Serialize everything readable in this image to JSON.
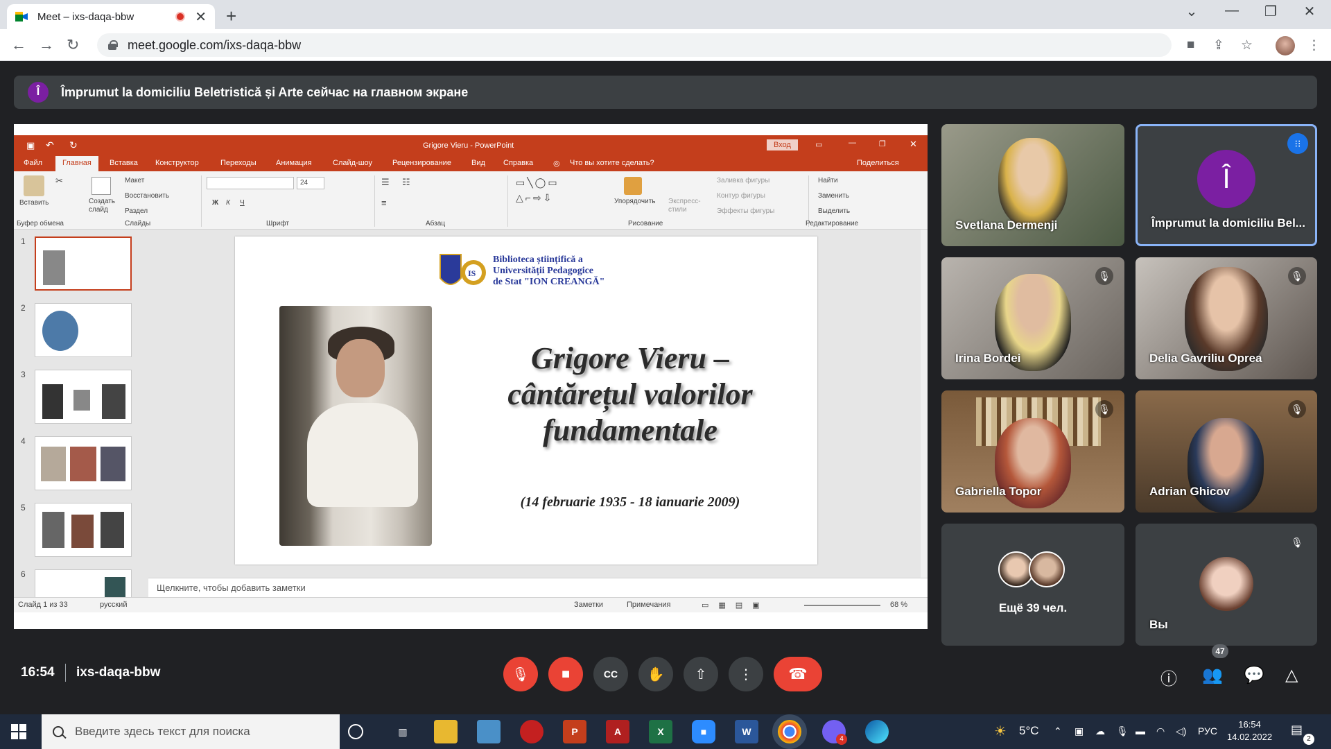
{
  "browser": {
    "tab_title": "Meet – ixs-daqa-bbw",
    "tab_close": "✕",
    "new_tab": "+",
    "url": "meet.google.com/ixs-daqa-bbw",
    "window_controls": [
      "⌄",
      "—",
      "❐",
      "✕"
    ]
  },
  "banner": {
    "avatar_letter": "Î",
    "text": "Împrumut la domiciliu Beletristică și Arte сейчас на главном экране"
  },
  "powerpoint": {
    "title": "Grigore Vieru - PowerPoint",
    "login": "Вход",
    "tabs": [
      "Файл",
      "Главная",
      "Вставка",
      "Конструктор",
      "Переходы",
      "Анимация",
      "Слайд-шоу",
      "Рецензирование",
      "Вид",
      "Справка",
      "Что вы хотите сделать?"
    ],
    "share": "Поделиться",
    "ribbon": {
      "paste": "Вставить",
      "new_slide": "Создать слайд",
      "layout": "Макет",
      "reset": "Восстановить",
      "section": "Раздел",
      "font_size": "24",
      "arrange": "Упорядочить",
      "quick_styles": "Экспресс-стили",
      "shape_fill": "Заливка фигуры",
      "shape_outline": "Контур фигуры",
      "shape_effects": "Эффекты фигуры",
      "find": "Найти",
      "replace": "Заменить",
      "select": "Выделить",
      "groups": [
        "Буфер обмена",
        "Слайды",
        "Шрифт",
        "Абзац",
        "Рисование",
        "Редактирование"
      ]
    },
    "thumbs": [
      "1",
      "2",
      "3",
      "4",
      "5",
      "6"
    ],
    "slide": {
      "logo_text": [
        "Biblioteca științifică a",
        "Universității Pedagogice",
        "de Stat \"ION CREANGĂ\""
      ],
      "title_lines": [
        "Grigore Vieru –",
        "cântărețul valorilor",
        "fundamentale"
      ],
      "dates": "(14 februarie 1935 - 18 ianuarie 2009)"
    },
    "notes_placeholder": "Щелкните, чтобы добавить заметки",
    "status": {
      "slide_count": "Слайд 1 из 33",
      "language": "русский",
      "notes": "Заметки",
      "comments": "Примечания",
      "zoom": "68 %"
    }
  },
  "participants": [
    {
      "name": "Svetlana Dermenji"
    },
    {
      "name": "Împrumut la domiciliu Bel...",
      "letter": "Î"
    },
    {
      "name": "Irina Bordei"
    },
    {
      "name": "Delia Gavriliu Oprea"
    },
    {
      "name": "Gabriella Topor"
    },
    {
      "name": "Adrian Ghicov"
    },
    {
      "name": "Ещё 39 чел."
    },
    {
      "name": "Вы"
    }
  ],
  "controls": {
    "time": "16:54",
    "meeting_code": "ixs-daqa-bbw",
    "participant_count": "47"
  },
  "taskbar": {
    "search_placeholder": "Введите здесь текст для поиска",
    "weather": "5°C",
    "lang": "РУС",
    "time": "16:54",
    "date": "14.02.2022",
    "notif_count": "2",
    "viber_badge": "4"
  },
  "colors": {
    "ppt_accent": "#c43e1c",
    "meet_bg": "#202124",
    "danger": "#ea4335",
    "speaker_border": "#8ab4f8"
  }
}
